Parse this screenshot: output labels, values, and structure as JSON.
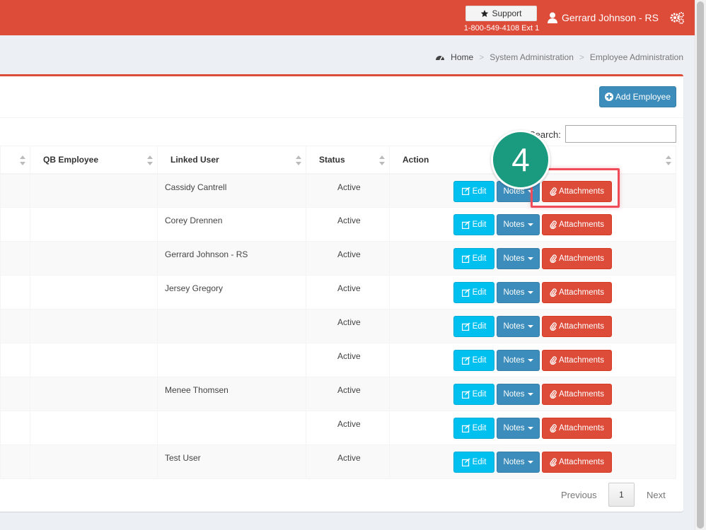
{
  "header": {
    "support_label": "Support",
    "support_phone": "1-800-549-4108 Ext 1",
    "user_name": "Gerrard Johnson - RS"
  },
  "breadcrumb": [
    "Home",
    "System Administration",
    "Employee Administration"
  ],
  "toolbar": {
    "add_employee_label": "Add Employee"
  },
  "search": {
    "label": "Search:",
    "value": ""
  },
  "table": {
    "columns": [
      "QB Employee",
      "Linked User",
      "Status",
      "Action"
    ],
    "rows": [
      {
        "qb_employee": "",
        "linked_user": "Cassidy Cantrell",
        "status": "Active"
      },
      {
        "qb_employee": "",
        "linked_user": "Corey Drennen",
        "status": "Active"
      },
      {
        "qb_employee": "",
        "linked_user": "Gerrard Johnson - RS",
        "status": "Active"
      },
      {
        "qb_employee": "",
        "linked_user": "Jersey Gregory",
        "status": "Active"
      },
      {
        "qb_employee": "",
        "linked_user": "",
        "status": "Active"
      },
      {
        "qb_employee": "",
        "linked_user": "",
        "status": "Active"
      },
      {
        "qb_employee": "",
        "linked_user": "Menee Thomsen",
        "status": "Active"
      },
      {
        "qb_employee": "",
        "linked_user": "",
        "status": "Active"
      },
      {
        "qb_employee": "",
        "linked_user": "Test User",
        "status": "Active"
      }
    ],
    "actions": {
      "edit": "Edit",
      "notes": "Notes",
      "attachments": "Attachments"
    }
  },
  "pagination": {
    "previous": "Previous",
    "current": "1",
    "next": "Next"
  },
  "callout": {
    "step": "4"
  },
  "colors": {
    "topbar": "#dd4b39",
    "edit": "#00c0ef",
    "notes": "#3c8dbc",
    "attachments": "#dd4b39",
    "callout_circle": "#1a9a7f",
    "callout_box": "#ef4b58"
  }
}
